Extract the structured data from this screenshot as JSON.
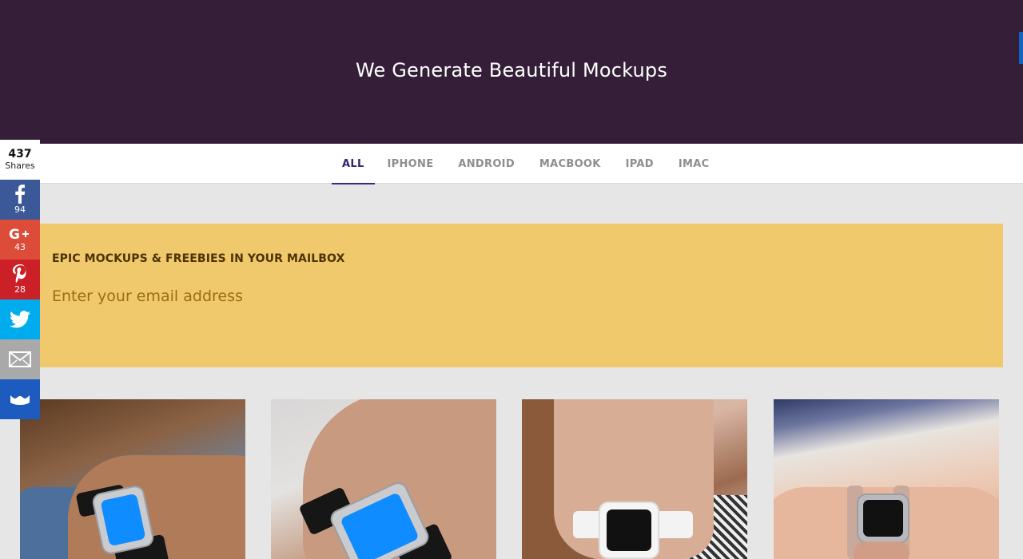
{
  "hero": {
    "title": "We Generate Beautiful Mockups"
  },
  "nav": {
    "tabs": [
      {
        "label": "ALL",
        "active": true
      },
      {
        "label": "IPHONE",
        "active": false
      },
      {
        "label": "ANDROID",
        "active": false
      },
      {
        "label": "MACBOOK",
        "active": false
      },
      {
        "label": "IPAD",
        "active": false
      },
      {
        "label": "IMAC",
        "active": false
      }
    ]
  },
  "share": {
    "total": "437",
    "total_label": "Shares",
    "buttons": [
      {
        "network": "facebook",
        "icon": "facebook-icon",
        "count": "94",
        "color": "#3b5998"
      },
      {
        "network": "google-plus",
        "icon": "google-plus-icon",
        "count": "43",
        "color": "#dd4b39"
      },
      {
        "network": "pinterest",
        "icon": "pinterest-icon",
        "count": "28",
        "color": "#cb2027"
      },
      {
        "network": "twitter",
        "icon": "twitter-icon",
        "count": "",
        "color": "#00aced"
      },
      {
        "network": "email",
        "icon": "email-icon",
        "count": "",
        "color": "#a9a9a9"
      },
      {
        "network": "sumome",
        "icon": "crown-icon",
        "count": "",
        "color": "#1d5bbf"
      }
    ]
  },
  "newsletter": {
    "heading": "EPIC MOCKUPS & FREEBIES IN YOUR MAILBOX",
    "email_value": "",
    "email_placeholder": "Enter your email address",
    "background": "#f1c96d"
  },
  "colors": {
    "hero_bg": "#341e38",
    "accent": "#322572",
    "page_bg": "#e6e6e6"
  },
  "gallery": [
    {
      "subject": "apple-watch-mockup",
      "screen": "blue"
    },
    {
      "subject": "apple-watch-mockup",
      "screen": "blue"
    },
    {
      "subject": "apple-watch-mockup",
      "screen": "dark"
    },
    {
      "subject": "apple-watch-mockup",
      "screen": "dark"
    }
  ]
}
